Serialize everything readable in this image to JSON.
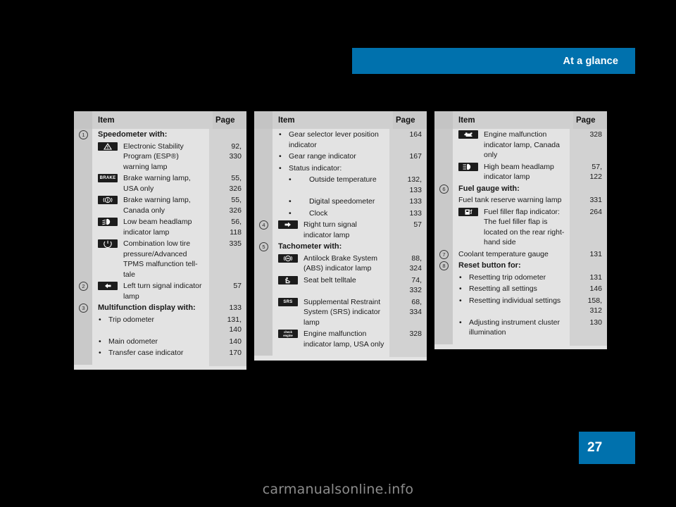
{
  "header": {
    "title": "At a glance",
    "accent_color": "#0071ad"
  },
  "page": {
    "number": "27",
    "watermark": "carmanualsonline.info"
  },
  "columns": [
    {
      "header": {
        "item": "Item",
        "page": "Page"
      },
      "rows": [
        {
          "marker": "1",
          "kind": "heading",
          "text": "Speedometer with:",
          "pages": ""
        },
        {
          "marker": "",
          "kind": "icon",
          "icon": "esp-warning-triangle-icon",
          "text": "Electronic Stability Program (ESP®) warning lamp",
          "pages": "92,\n330"
        },
        {
          "marker": "",
          "kind": "icon",
          "icon": "brake-text-icon",
          "text": "Brake warning lamp, USA only",
          "pages": "55,\n326"
        },
        {
          "marker": "",
          "kind": "icon",
          "icon": "brake-circle-icon",
          "text": "Brake warning lamp, Canada only",
          "pages": "55,\n326"
        },
        {
          "marker": "",
          "kind": "icon",
          "icon": "low-beam-headlamp-icon",
          "text": "Low beam headlamp indicator lamp",
          "pages": "56,\n118"
        },
        {
          "marker": "",
          "kind": "icon",
          "icon": "tire-pressure-icon",
          "text": "Combination low tire pressure/Advanced TPMS malfunction tell-tale",
          "pages": "335"
        },
        {
          "marker": "2",
          "kind": "icon",
          "icon": "left-turn-signal-icon",
          "text": "Left turn signal indicator lamp",
          "pages": "57"
        },
        {
          "marker": "3",
          "kind": "heading",
          "text": "Multifunction display with:",
          "pages": "133"
        },
        {
          "marker": "",
          "kind": "bullet",
          "text": "Trip odometer",
          "pages": "131,\n140"
        },
        {
          "marker": "",
          "kind": "bullet",
          "text": "Main odometer",
          "pages": "140"
        },
        {
          "marker": "",
          "kind": "bullet",
          "text": "Transfer case indicator",
          "pages": "170"
        }
      ]
    },
    {
      "header": {
        "item": "Item",
        "page": "Page"
      },
      "rows": [
        {
          "marker": "",
          "kind": "bullet",
          "text": "Gear selector lever position indicator",
          "pages": "164"
        },
        {
          "marker": "",
          "kind": "bullet",
          "text": "Gear range indicator",
          "pages": "167"
        },
        {
          "marker": "",
          "kind": "bullet",
          "text": "Status indicator:",
          "pages": ""
        },
        {
          "marker": "",
          "kind": "subbullet",
          "text": "Outside temperature",
          "pages": "132,\n133"
        },
        {
          "marker": "",
          "kind": "subbullet",
          "text": "Digital speedometer",
          "pages": "133"
        },
        {
          "marker": "",
          "kind": "subbullet",
          "text": "Clock",
          "pages": "133"
        },
        {
          "marker": "4",
          "kind": "icon",
          "icon": "right-turn-signal-icon",
          "text": "Right turn signal indicator lamp",
          "pages": "57"
        },
        {
          "marker": "5",
          "kind": "heading",
          "text": "Tachometer with:",
          "pages": ""
        },
        {
          "marker": "",
          "kind": "icon",
          "icon": "abs-icon",
          "text": "Antilock Brake System (ABS) indicator lamp",
          "pages": "88,\n324"
        },
        {
          "marker": "",
          "kind": "icon",
          "icon": "seat-belt-icon",
          "text": "Seat belt telltale",
          "pages": "74,\n332"
        },
        {
          "marker": "",
          "kind": "icon",
          "icon": "srs-icon",
          "text": "Supplemental Restraint System (SRS) indicator lamp",
          "pages": "68,\n334"
        },
        {
          "marker": "",
          "kind": "icon",
          "icon": "check-engine-text-icon",
          "text": "Engine malfunction indicator lamp, USA only",
          "pages": "328"
        }
      ]
    },
    {
      "header": {
        "item": "Item",
        "page": "Page"
      },
      "rows": [
        {
          "marker": "",
          "kind": "icon",
          "icon": "engine-malfunction-icon",
          "text": "Engine malfunction indicator lamp, Canada only",
          "pages": "328"
        },
        {
          "marker": "",
          "kind": "icon",
          "icon": "high-beam-headlamp-icon",
          "text": "High beam headlamp indicator lamp",
          "pages": "57,\n122"
        },
        {
          "marker": "6",
          "kind": "heading",
          "text": "Fuel gauge with:",
          "pages": ""
        },
        {
          "marker": "",
          "kind": "plain",
          "text": "Fuel tank reserve warning lamp",
          "pages": "331"
        },
        {
          "marker": "",
          "kind": "icon",
          "icon": "fuel-filler-flap-icon",
          "text": "Fuel filler flap indicator: The fuel filler flap is located on the rear right-hand side",
          "pages": "264"
        },
        {
          "marker": "7",
          "kind": "plain",
          "text": "Coolant temperature gauge",
          "pages": "131"
        },
        {
          "marker": "8",
          "kind": "heading",
          "text": "Reset button for:",
          "pages": ""
        },
        {
          "marker": "",
          "kind": "bullet",
          "text": "Resetting trip odometer",
          "pages": "131"
        },
        {
          "marker": "",
          "kind": "bullet",
          "text": "Resetting all settings",
          "pages": "146"
        },
        {
          "marker": "",
          "kind": "bullet",
          "text": "Resetting individual settings",
          "pages": "158,\n312"
        },
        {
          "marker": "",
          "kind": "bullet",
          "text": "Adjusting instrument cluster illumination",
          "pages": "130"
        }
      ]
    }
  ]
}
